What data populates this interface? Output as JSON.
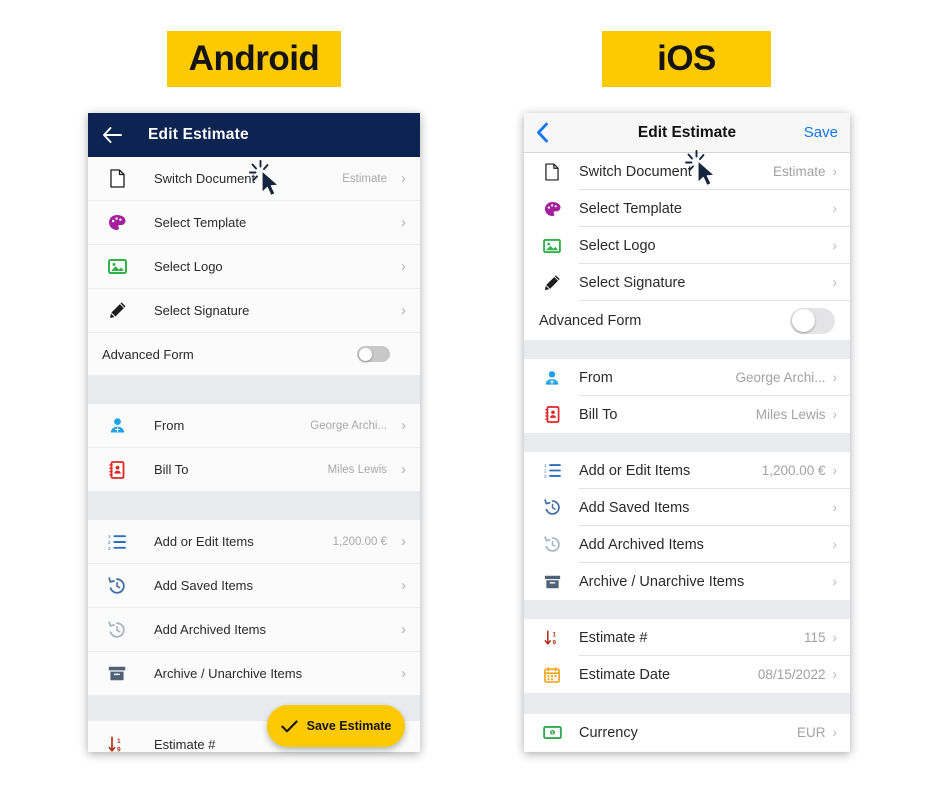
{
  "platform_labels": {
    "android": "Android",
    "ios": "iOS"
  },
  "colors": {
    "brand_yellow": "#fdc900",
    "android_header_navy": "#0d2352",
    "ios_blue": "#1277f2",
    "section_gap_gray": "#e9ebee"
  },
  "android": {
    "header": {
      "back_icon": "arrow-left-icon",
      "title": "Edit Estimate"
    },
    "rows": [
      {
        "icon": "document-icon",
        "label": "Switch Document",
        "value": "Estimate",
        "chevron": "›"
      },
      {
        "icon": "palette-icon",
        "label": "Select Template",
        "value": "",
        "chevron": "›"
      },
      {
        "icon": "image-icon",
        "label": "Select Logo",
        "value": "",
        "chevron": "›"
      },
      {
        "icon": "pencil-icon",
        "label": "Select Signature",
        "value": "",
        "chevron": "›"
      },
      {
        "icon": "",
        "label": "Advanced Form",
        "value": "",
        "toggle": "off"
      },
      {
        "icon": "person-icon",
        "label": "From",
        "value": "George Archi...",
        "chevron": "›"
      },
      {
        "icon": "contact-card-icon",
        "label": "Bill To",
        "value": "Miles Lewis",
        "chevron": "›"
      },
      {
        "icon": "numbered-list-icon",
        "label": "Add or Edit Items",
        "value": "1,200.00 €",
        "chevron": "›"
      },
      {
        "icon": "history-icon",
        "label": "Add Saved Items",
        "value": "",
        "chevron": "›"
      },
      {
        "icon": "history-muted-icon",
        "label": "Add Archived Items",
        "value": "",
        "chevron": "›"
      },
      {
        "icon": "archive-box-icon",
        "label": "Archive / Unarchive Items",
        "value": "",
        "chevron": "›"
      },
      {
        "icon": "sort-numeric-icon",
        "label": "Estimate #",
        "value": "",
        "chevron": ""
      }
    ],
    "save_button": {
      "label": "Save Estimate",
      "check_icon": "check-icon"
    },
    "cursor_icon": "click-cursor-icon"
  },
  "ios": {
    "header": {
      "back_icon": "chevron-left-icon",
      "title": "Edit Estimate",
      "save_label": "Save"
    },
    "rows": [
      {
        "icon": "document-icon",
        "label": "Switch Document",
        "value": "Estimate",
        "chevron": "›"
      },
      {
        "icon": "palette-icon",
        "label": "Select Template",
        "value": "",
        "chevron": "›"
      },
      {
        "icon": "image-icon",
        "label": "Select Logo",
        "value": "",
        "chevron": "›"
      },
      {
        "icon": "pencil-icon",
        "label": "Select Signature",
        "value": "",
        "chevron": "›"
      },
      {
        "icon": "",
        "label": "Advanced Form",
        "value": "",
        "toggle": "off"
      },
      {
        "icon": "person-icon",
        "label": "From",
        "value": "George Archi...",
        "chevron": "›"
      },
      {
        "icon": "contact-card-icon",
        "label": "Bill To",
        "value": "Miles Lewis",
        "chevron": "›"
      },
      {
        "icon": "numbered-list-icon",
        "label": "Add or Edit Items",
        "value": "1,200.00 €",
        "chevron": "›"
      },
      {
        "icon": "history-icon",
        "label": "Add Saved Items",
        "value": "",
        "chevron": "›"
      },
      {
        "icon": "history-muted-icon",
        "label": "Add Archived Items",
        "value": "",
        "chevron": "›"
      },
      {
        "icon": "archive-box-icon",
        "label": "Archive / Unarchive Items",
        "value": "",
        "chevron": "›"
      },
      {
        "icon": "sort-numeric-icon",
        "label": "Estimate #",
        "value": "115",
        "chevron": "›"
      },
      {
        "icon": "calendar-icon",
        "label": "Estimate Date",
        "value": "08/15/2022",
        "chevron": "›"
      },
      {
        "icon": "banknote-icon",
        "label": "Currency",
        "value": "EUR",
        "chevron": "›"
      }
    ],
    "cursor_icon": "click-cursor-icon"
  }
}
